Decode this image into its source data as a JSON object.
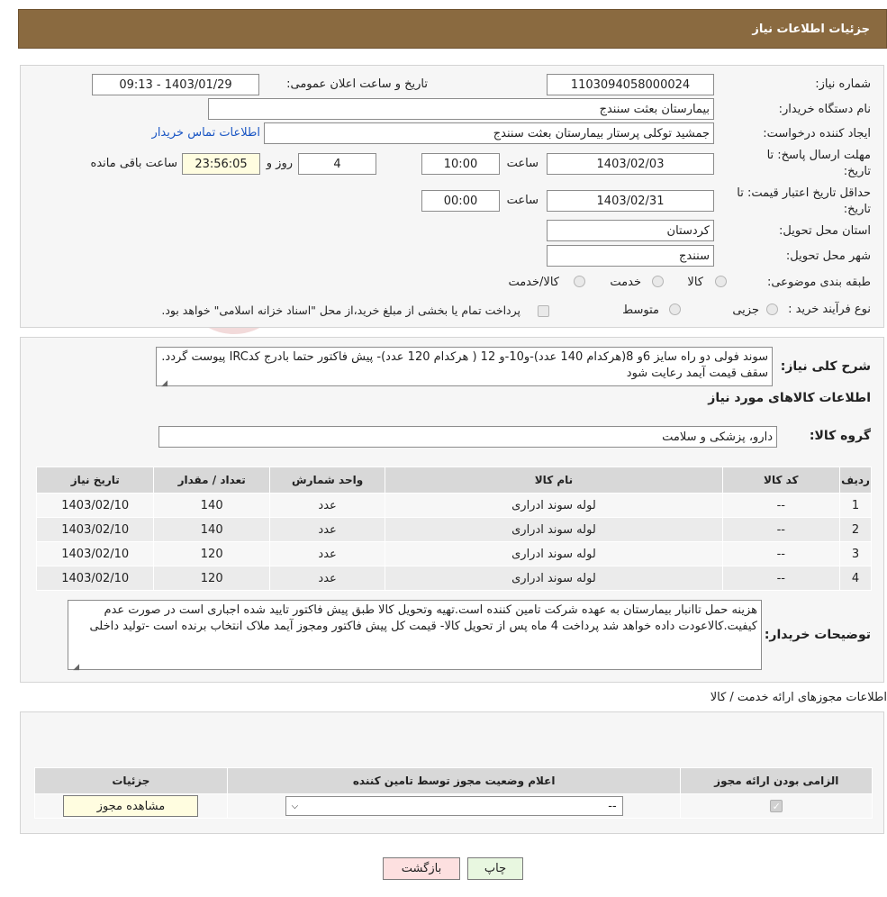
{
  "header": {
    "title": "جزئیات اطلاعات نیاز"
  },
  "form": {
    "need_number_label": "شماره نیاز:",
    "need_number": "1103094058000024",
    "announce_label": "تاریخ و ساعت اعلان عمومی:",
    "announce_value": "1403/01/29 - 09:13",
    "buyer_org_label": "نام دستگاه خریدار:",
    "buyer_org": "بیمارستان بعثت سنندج",
    "requester_label": "ایجاد کننده درخواست:",
    "requester": "جمشید  توکلی پرستار بیمارستان بعثت سنندج",
    "contact_link": "اطلاعات تماس خریدار",
    "deadline_label_1": "مهلت ارسال پاسخ: تا",
    "deadline_label_2": "تاریخ:",
    "deadline_date": "1403/02/03",
    "time_label": "ساعت",
    "deadline_time": "10:00",
    "days": "4",
    "days_label": "روز و",
    "remaining": "23:56:05",
    "remaining_label": "ساعت باقی مانده",
    "validity_label_1": "حداقل تاریخ اعتبار قیمت: تا",
    "validity_label_2": "تاریخ:",
    "validity_date": "1403/02/31",
    "validity_time": "00:00",
    "province_label": "استان محل تحویل:",
    "province": "کردستان",
    "city_label": "شهر محل تحویل:",
    "city": "سنندج",
    "category_label": "طبقه بندی موضوعی:",
    "category_options": [
      "کالا",
      "خدمت",
      "کالا/خدمت"
    ],
    "process_label": "نوع فرآیند خرید :",
    "process_options": [
      "جزیی",
      "متوسط"
    ],
    "process_note": "پرداخت تمام یا بخشی از مبلغ خرید،از محل \"اسناد خزانه اسلامی\" خواهد بود."
  },
  "details": {
    "summary_label": "شرح کلی نیاز:",
    "summary_text": "سوند فولی دو راه سایز 6و 8(هرکدام 140 عدد)-و10-و 12 ( هرکدام 120 عدد)- پیش فاکتور حتما بادرج کدIRC پیوست گردد. سقف قیمت آیمد رعایت شود",
    "goods_info_title": "اطلاعات کالاهای مورد نیاز",
    "goods_group_label": "گروه کالا:",
    "goods_group": "دارو، پزشکی و سلامت",
    "table_headers": [
      "ردیف",
      "کد کالا",
      "نام کالا",
      "واحد شمارش",
      "تعداد / مقدار",
      "تاریخ نیاز"
    ],
    "rows": [
      [
        "1",
        "--",
        "لوله سوند ادراری",
        "عدد",
        "140",
        "1403/02/10"
      ],
      [
        "2",
        "--",
        "لوله سوند ادراری",
        "عدد",
        "140",
        "1403/02/10"
      ],
      [
        "3",
        "--",
        "لوله سوند ادراری",
        "عدد",
        "120",
        "1403/02/10"
      ],
      [
        "4",
        "--",
        "لوله سوند ادراری",
        "عدد",
        "120",
        "1403/02/10"
      ]
    ],
    "buyer_notes_label": "توضیحات خریدار:",
    "buyer_notes": "هزینه حمل تاانبار بیمارستان به عهده شرکت تامین کننده است.تهیه وتحویل کالا طبق پیش فاکتور تایید شده اجباری است در صورت عدم کیفیت.کالاعودت داده خواهد شد پرداخت 4 ماه پس از تحویل کالا- قیمت کل پیش فاکتور ومجوز آیمد ملاک انتخاب برنده است -تولید داخلی"
  },
  "permits": {
    "title": "اطلاعات مجوزهای ارائه خدمت / کالا",
    "headers": [
      "الزامی بودن ارائه مجوز",
      "اعلام وضعیت مجوز توسط تامین کننده",
      "جزئیات"
    ],
    "select_value": "--",
    "view_button": "مشاهده مجوز"
  },
  "footer": {
    "print_button": "چاپ",
    "back_button": "بازگشت"
  },
  "colors": {
    "header_bg": "#8a6a40",
    "back_button_bg": "#fde0e0",
    "print_button_bg": "#e8f7e0",
    "highlight_bg": "#fffde0"
  }
}
